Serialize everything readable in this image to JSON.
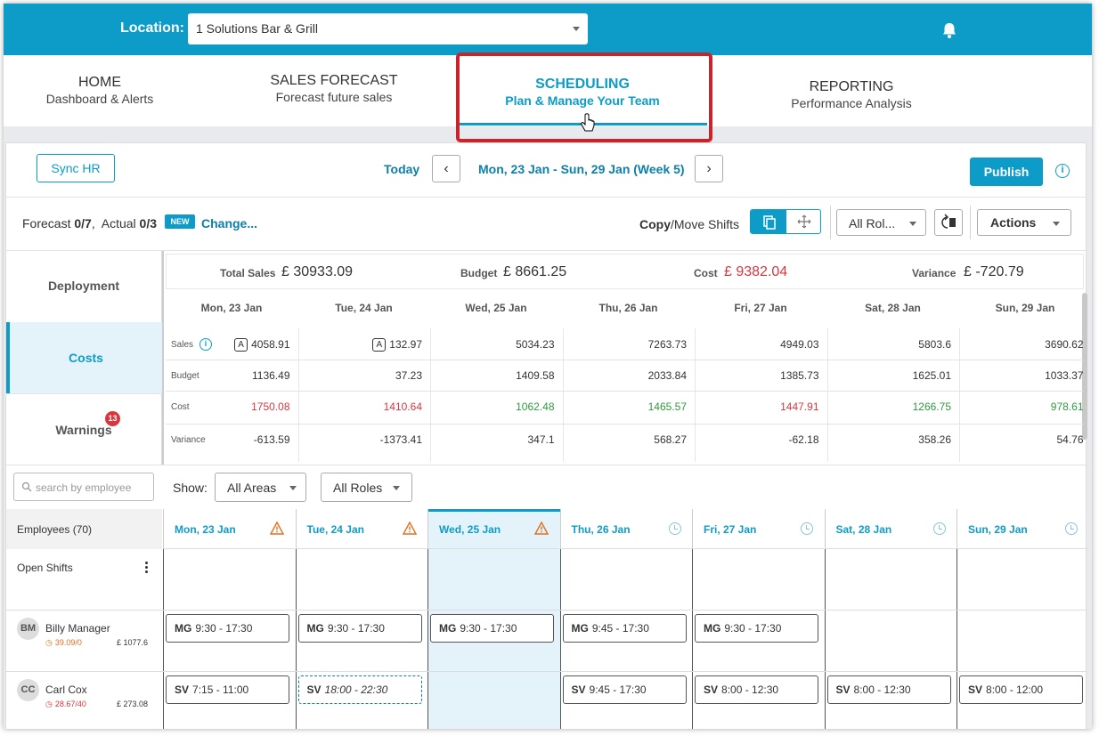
{
  "header": {
    "location_label": "Location:",
    "location_value": "1 Solutions Bar & Grill"
  },
  "nav": [
    {
      "title": "HOME",
      "subtitle": "Dashboard & Alerts"
    },
    {
      "title": "SALES FORECAST",
      "subtitle": "Forecast future sales"
    },
    {
      "title": "SCHEDULING",
      "subtitle": "Plan & Manage Your Team"
    },
    {
      "title": "REPORTING",
      "subtitle": "Performance Analysis"
    }
  ],
  "toolbar": {
    "sync_label": "Sync HR",
    "today_label": "Today",
    "prev_icon": "‹",
    "next_icon": "›",
    "date_range": "Mon, 23 Jan - Sun, 29 Jan (Week 5)",
    "publish_label": "Publish"
  },
  "forecast": {
    "forecast_label": "Forecast",
    "forecast_value": "0/7",
    "actual_label": "Actual",
    "actual_value": "0/3",
    "new_badge": "NEW",
    "change_link": "Change...",
    "copy_label": "Copy",
    "move_label": "/Move Shifts",
    "roles_filter": "All Rol...",
    "actions_label": "Actions"
  },
  "sidetabs": {
    "deployment": "Deployment",
    "costs": "Costs",
    "warnings": "Warnings",
    "warnings_count": "13"
  },
  "summary": {
    "total_sales_label": "Total Sales",
    "total_sales": "£ 30933.09",
    "budget_label": "Budget",
    "budget": "£ 8661.25",
    "cost_label": "Cost",
    "cost": "£ 9382.04",
    "variance_label": "Variance",
    "variance": "£ -720.79"
  },
  "days": [
    "Mon, 23 Jan",
    "Tue, 24 Jan",
    "Wed, 25 Jan",
    "Thu, 26 Jan",
    "Fri, 27 Jan",
    "Sat, 28 Jan",
    "Sun, 29 Jan"
  ],
  "costs": {
    "row_labels": [
      "Sales",
      "Budget",
      "Cost",
      "Variance"
    ],
    "actual_badge": "A",
    "sales": [
      "4058.91",
      "132.97",
      "5034.23",
      "7263.73",
      "4949.03",
      "5803.6",
      "3690.62"
    ],
    "budget": [
      "1136.49",
      "37.23",
      "1409.58",
      "2033.84",
      "1385.73",
      "1625.01",
      "1033.37"
    ],
    "cost": [
      "1750.08",
      "1410.64",
      "1062.48",
      "1465.57",
      "1447.91",
      "1266.75",
      "978.61"
    ],
    "variance": [
      "-613.59",
      "-1373.41",
      "347.1",
      "568.27",
      "-62.18",
      "358.26",
      "54.76"
    ]
  },
  "colors": {
    "accent": "#0d9cc8",
    "over_budget": "#d9363e",
    "under_budget": "#2e9a3e",
    "warning": "#e07020",
    "highlight_border": "#c8242b"
  },
  "filters": {
    "search_placeholder": "search by employee",
    "show_label": "Show:",
    "areas": "All Areas",
    "roles": "All Roles"
  },
  "schedule": {
    "employees_label": "Employees (70)",
    "open_shifts_label": "Open Shifts",
    "day_icons": [
      "warning-icon",
      "warning-icon",
      "warning-icon",
      "clock-icon",
      "clock-icon",
      "clock-icon",
      "clock-icon"
    ],
    "employees": [
      {
        "initials": "BM",
        "name": "Billy Manager",
        "hours": "39.09/0",
        "cost": "£ 1077.6",
        "shifts": [
          {
            "role": "MG",
            "time": "9:30 - 17:30"
          },
          {
            "role": "MG",
            "time": "9:30 - 17:30"
          },
          {
            "role": "MG",
            "time": "9:30 - 17:30"
          },
          {
            "role": "MG",
            "time": "9:45 - 17:30"
          },
          {
            "role": "MG",
            "time": "9:30 - 17:30"
          },
          null,
          null
        ]
      },
      {
        "initials": "CC",
        "name": "Carl Cox",
        "hours": "28.67/40",
        "cost": "£ 273.08",
        "shifts": [
          {
            "role": "SV",
            "time": "7:15 - 11:00"
          },
          {
            "role": "SV",
            "time": "18:00 - 22:30",
            "unpublished": true
          },
          null,
          {
            "role": "SV",
            "time": "9:45 - 17:30"
          },
          {
            "role": "SV",
            "time": "8:00 - 12:30"
          },
          {
            "role": "SV",
            "time": "8:00 - 12:30"
          },
          {
            "role": "SV",
            "time": "8:00 - 12:00"
          }
        ]
      }
    ]
  }
}
